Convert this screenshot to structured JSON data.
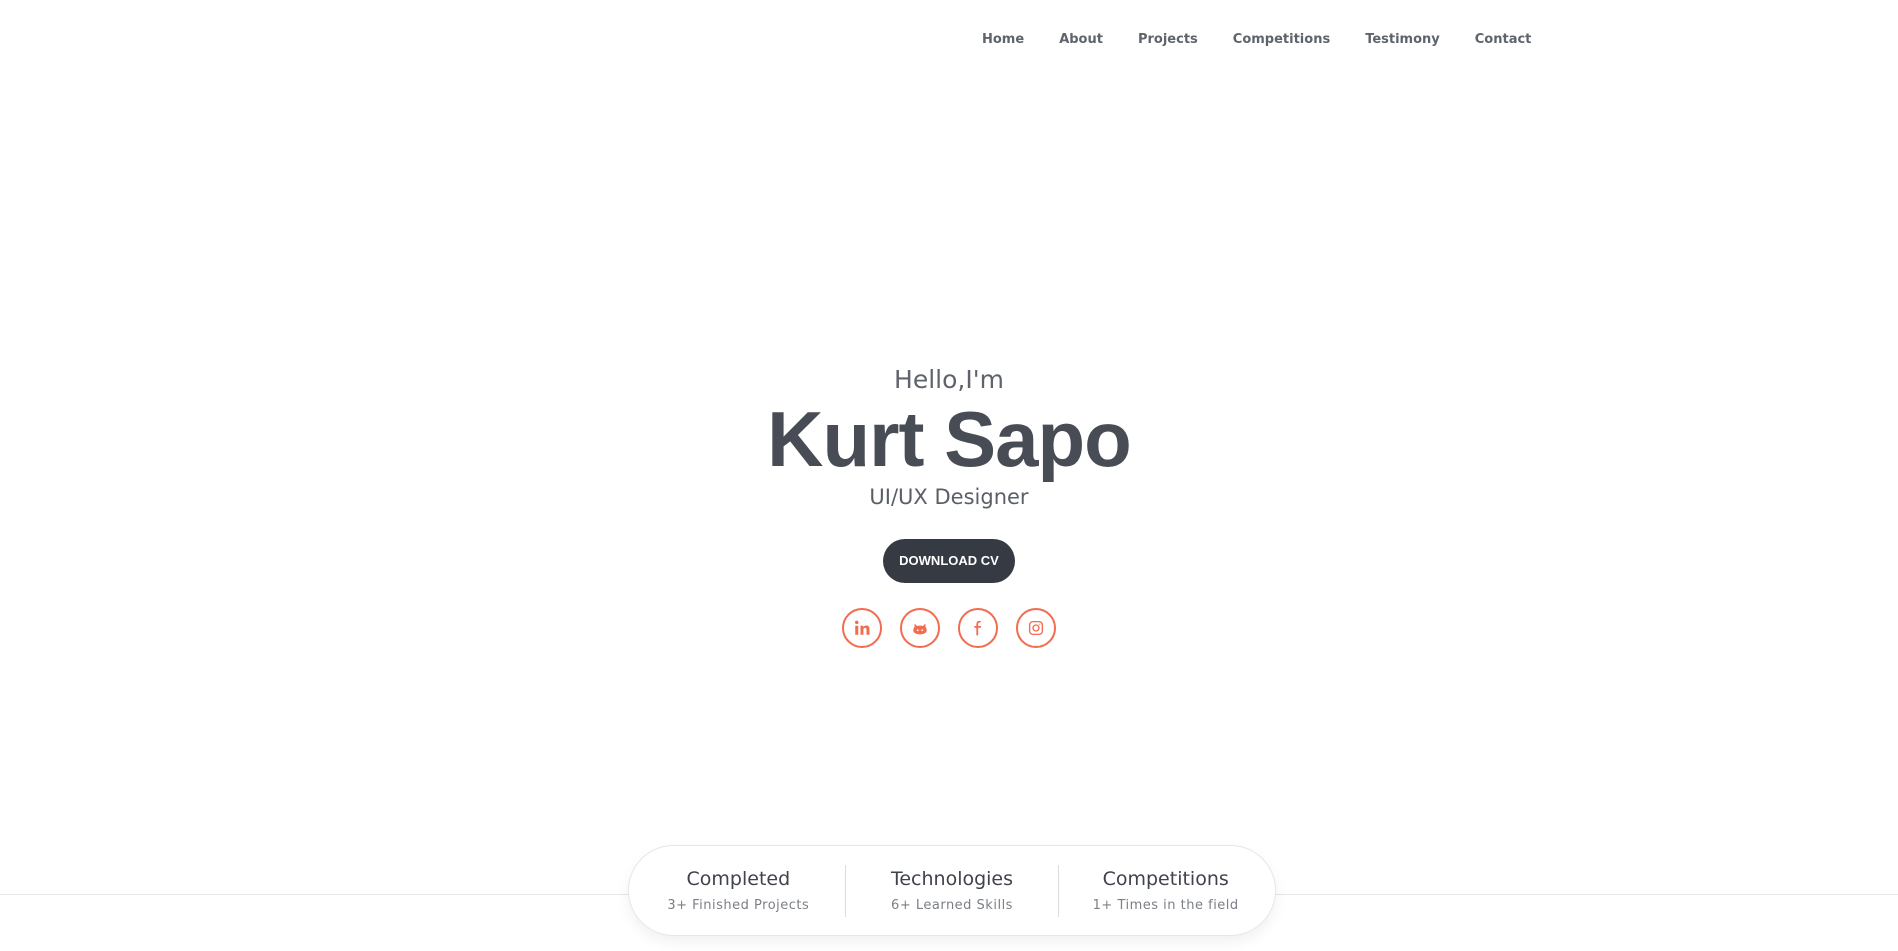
{
  "nav": {
    "items": [
      {
        "label": "Home"
      },
      {
        "label": "About"
      },
      {
        "label": "Projects"
      },
      {
        "label": "Competitions"
      },
      {
        "label": "Testimony"
      },
      {
        "label": "Contact"
      }
    ]
  },
  "hero": {
    "greeting": "Hello,I'm",
    "name": "Kurt Sapo",
    "role": "UI/UX Designer",
    "cta_label": "DOWNLOAD CV"
  },
  "socials": [
    {
      "icon": "linkedin-icon"
    },
    {
      "icon": "github-icon"
    },
    {
      "icon": "facebook-icon"
    },
    {
      "icon": "instagram-icon"
    }
  ],
  "stats": [
    {
      "title": "Completed",
      "subtitle": "3+ Finished Projects"
    },
    {
      "title": "Technologies",
      "subtitle": "6+ Learned Skills"
    },
    {
      "title": "Competitions",
      "subtitle": "1+ Times in the field"
    }
  ],
  "colors": {
    "accent": "#f26c4f",
    "dark": "#363a42",
    "text": "#474c55"
  }
}
